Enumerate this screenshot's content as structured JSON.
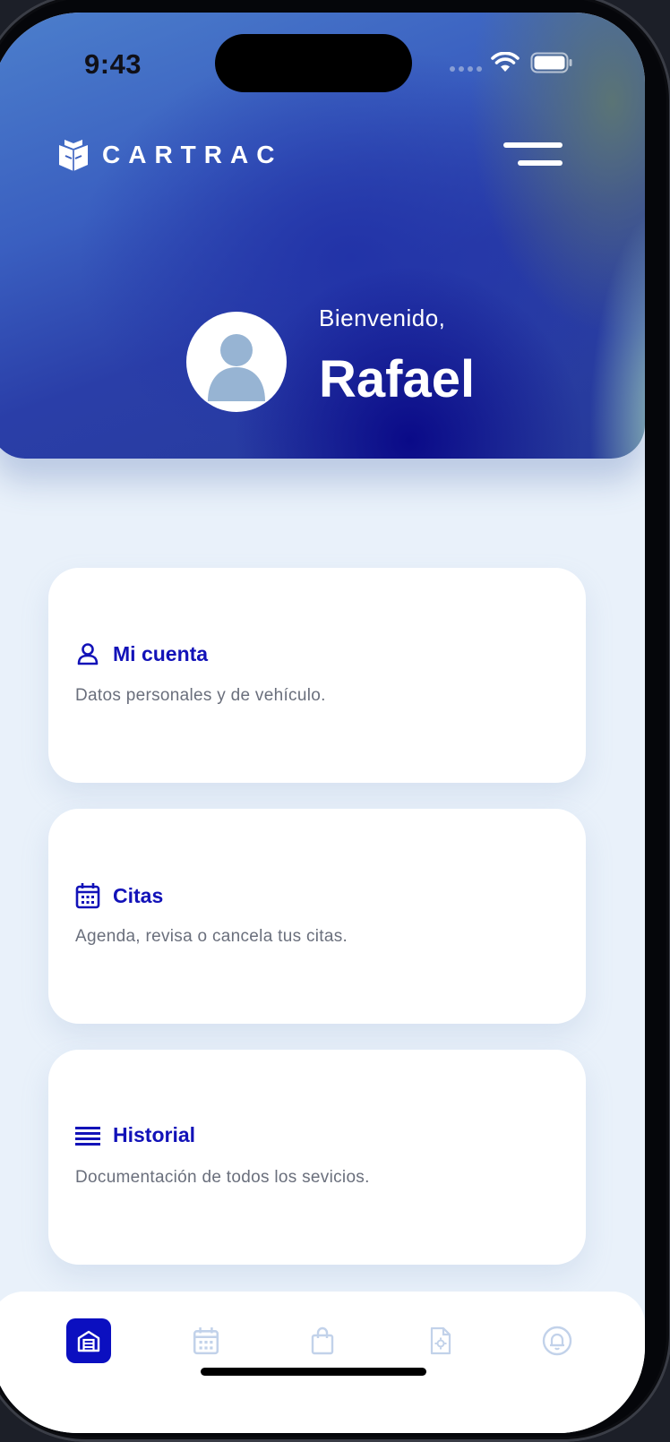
{
  "status_bar": {
    "time": "9:43"
  },
  "brand": {
    "name": "CARTRAC"
  },
  "welcome": {
    "greeting": "Bienvenido,",
    "name": "Rafael"
  },
  "cards": [
    {
      "title": "Mi cuenta",
      "description": "Datos personales y de vehículo.",
      "icon": "user-icon"
    },
    {
      "title": "Citas",
      "description": "Agenda, revisa o cancela tus citas.",
      "icon": "calendar-icon"
    },
    {
      "title": "Historial",
      "description": "Documentación de todos los sevicios.",
      "icon": "list-icon"
    }
  ],
  "tabbar": {
    "items": [
      "home-icon",
      "calendar-icon",
      "shopping-bag-icon",
      "document-settings-icon",
      "bell-icon"
    ],
    "active": "home-icon"
  },
  "colors": {
    "accent": "#0b0fc0",
    "card_title": "#1212b8",
    "background": "#e9f1fa",
    "inactive_icon": "#c2d2ea"
  }
}
